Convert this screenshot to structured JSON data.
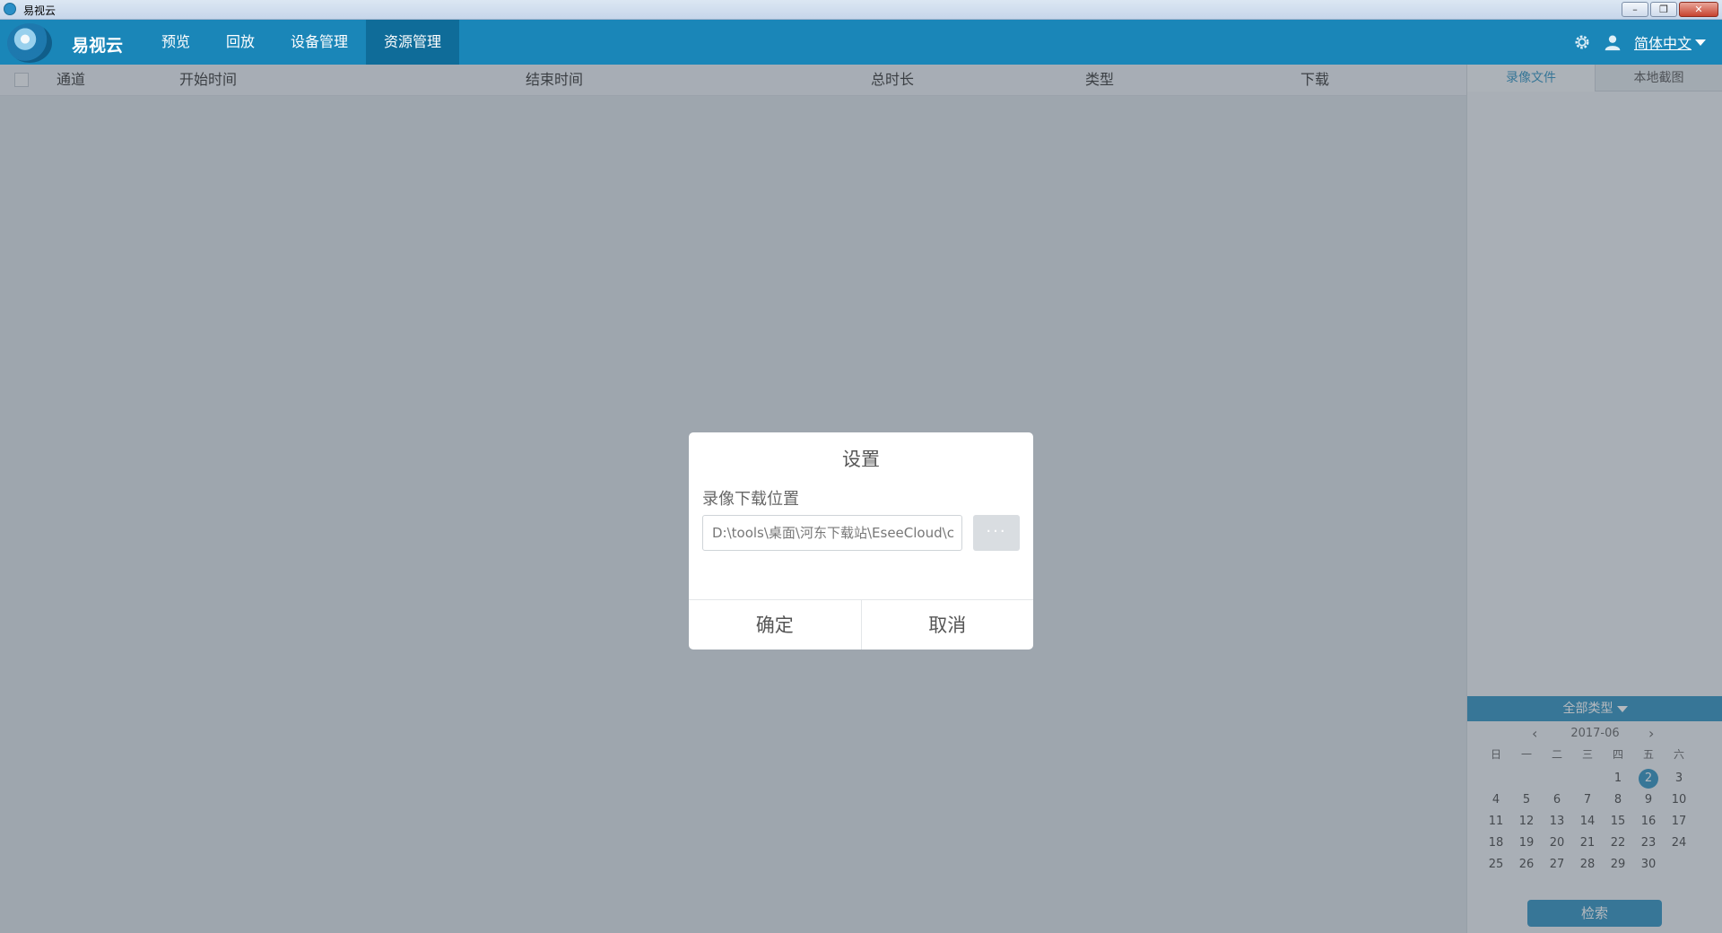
{
  "window": {
    "title": "易视云",
    "minimize": "–",
    "maximize": "❐",
    "close": "✕"
  },
  "app": {
    "name": "易视云"
  },
  "nav": {
    "tabs": [
      {
        "label": "预览"
      },
      {
        "label": "回放"
      },
      {
        "label": "设备管理"
      },
      {
        "label": "资源管理"
      }
    ],
    "active_tab": "资源管理",
    "language": "简体中文"
  },
  "table": {
    "columns": [
      "通道",
      "开始时间",
      "结束时间",
      "总时长",
      "类型",
      "下载"
    ]
  },
  "right_panel": {
    "tabs": [
      "录像文件",
      "本地截图"
    ],
    "filter": "全部类型",
    "calendar": {
      "month": "2017-06",
      "weekdays": [
        "日",
        "一",
        "二",
        "三",
        "四",
        "五",
        "六"
      ],
      "weeks": [
        [
          "",
          "",
          "",
          "",
          "1",
          "2",
          "3"
        ],
        [
          "4",
          "5",
          "6",
          "7",
          "8",
          "9",
          "10"
        ],
        [
          "11",
          "12",
          "13",
          "14",
          "15",
          "16",
          "17"
        ],
        [
          "18",
          "19",
          "20",
          "21",
          "22",
          "23",
          "24"
        ],
        [
          "25",
          "26",
          "27",
          "28",
          "29",
          "30",
          ""
        ]
      ],
      "selected_day": "2"
    },
    "search_label": "检索"
  },
  "dialog": {
    "title": "设置",
    "field_label": "录像下载位置",
    "path_value": "D:\\tools\\桌面\\河东下载站\\EseeCloud\\c",
    "browse_label": "···",
    "ok_label": "确定",
    "cancel_label": "取消"
  },
  "colors": {
    "accent": "#1a86b8",
    "active_tab": "#0f6c99"
  }
}
